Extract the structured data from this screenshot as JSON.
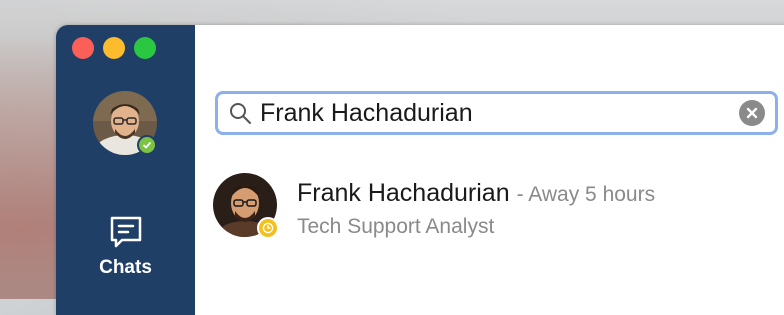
{
  "sidebar": {
    "window_controls": [
      "close",
      "minimize",
      "zoom"
    ],
    "user_avatar_icon": "user-photo",
    "user_status": "available",
    "nav": [
      {
        "label": "Chats",
        "icon": "chat-bubble-icon"
      }
    ]
  },
  "search": {
    "value": "Frank Hachadurian",
    "icon": "search-icon",
    "clear_icon": "clear-icon"
  },
  "results": [
    {
      "name": "Frank Hachadurian",
      "presence": "- Away 5 hours",
      "title": "Tech Support Analyst",
      "status": "away"
    }
  ],
  "colors": {
    "sidebar": "#1f3f66",
    "search_border": "#8cb1ea",
    "available": "#7cc243",
    "away": "#f3c01c",
    "close": "#fc5f57",
    "minimize": "#fdbb2e",
    "zoom": "#2ac740"
  }
}
